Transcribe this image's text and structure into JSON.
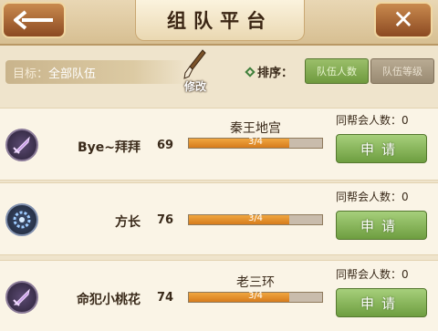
{
  "header": {
    "title": "组队平台",
    "back_icon": "arrow-left-icon",
    "close_icon": "close-icon",
    "close_glyph": "✕"
  },
  "filter": {
    "target_label": "目标：",
    "target_value": "全部队伍",
    "edit_label": "修改",
    "sort_label": "排序：",
    "sort_options": [
      "队伍人数",
      "队伍等级"
    ],
    "sort_selected": 0
  },
  "teams": [
    {
      "icon": "purple-sword-icon",
      "name": "Bye~拜拜",
      "level": "69",
      "dungeon": "秦王地宫",
      "members": "3/4",
      "members_fraction": 0.75,
      "guild_label": "同帮会人数：",
      "guild_count": "0",
      "apply_label": "申请"
    },
    {
      "icon": "blue-gear-icon",
      "name": "方长",
      "level": "76",
      "dungeon": "",
      "members": "3/4",
      "members_fraction": 0.75,
      "guild_label": "同帮会人数：",
      "guild_count": "0",
      "apply_label": "申请"
    },
    {
      "icon": "purple-sword-icon",
      "name": "命犯小桃花",
      "level": "74",
      "dungeon": "老三环",
      "members": "3/4",
      "members_fraction": 0.75,
      "guild_label": "同帮会人数：",
      "guild_count": "0",
      "apply_label": "申请"
    }
  ],
  "colors": {
    "accent_green": "#7aa84a",
    "bar_orange": "#e08a28",
    "panel_bg": "#faf4e6"
  }
}
